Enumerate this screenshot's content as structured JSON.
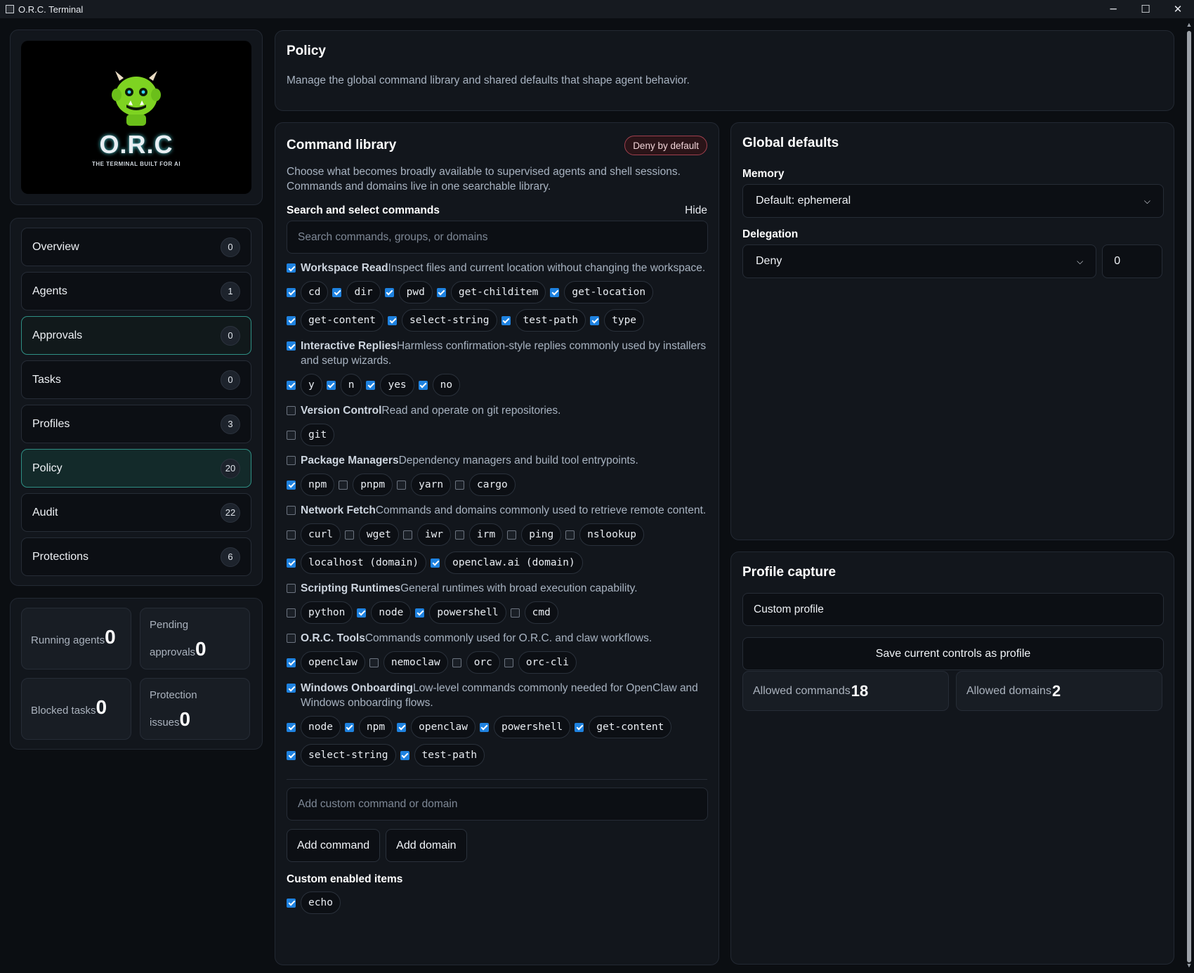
{
  "window": {
    "title": "O.R.C. Terminal",
    "minimize": "─",
    "maximize": "☐",
    "close": "✕"
  },
  "logo": {
    "title": "O.R.C",
    "subtitle": "THE TERMINAL BUILT FOR AI"
  },
  "nav": [
    {
      "label": "Overview",
      "count": "0"
    },
    {
      "label": "Agents",
      "count": "1"
    },
    {
      "label": "Approvals",
      "count": "0"
    },
    {
      "label": "Tasks",
      "count": "0"
    },
    {
      "label": "Profiles",
      "count": "3"
    },
    {
      "label": "Policy",
      "count": "20"
    },
    {
      "label": "Audit",
      "count": "22"
    },
    {
      "label": "Protections",
      "count": "6"
    }
  ],
  "stats": [
    {
      "label": "Running agents",
      "value": "0"
    },
    {
      "label": "Pending approvals",
      "value": "0"
    },
    {
      "label": "Blocked tasks",
      "value": "0"
    },
    {
      "label": "Protection issues",
      "value": "0"
    }
  ],
  "policy": {
    "title": "Policy",
    "description": "Manage the global command library and shared defaults that shape agent behavior."
  },
  "library": {
    "title": "Command library",
    "badge": "Deny by default",
    "description": "Choose what becomes broadly available to supervised agents and shell sessions. Commands and domains live in one searchable library.",
    "search_label": "Search and select commands",
    "hide_label": "Hide",
    "search_placeholder": "Search commands, groups, or domains",
    "groups": [
      {
        "name": "Workspace Read",
        "desc": "Inspect files and current location without changing the workspace.",
        "checked": true,
        "rows": [
          [
            {
              "label": "cd",
              "checked": true
            },
            {
              "label": "dir",
              "checked": true
            },
            {
              "label": "pwd",
              "checked": true
            },
            {
              "label": "get-childitem",
              "checked": true
            },
            {
              "label": "get-location",
              "checked": true
            }
          ],
          [
            {
              "label": "get-content",
              "checked": true
            },
            {
              "label": "select-string",
              "checked": true
            },
            {
              "label": "test-path",
              "checked": true
            },
            {
              "label": "type",
              "checked": true
            }
          ]
        ]
      },
      {
        "name": "Interactive Replies",
        "desc": "Harmless confirmation-style replies commonly used by installers and setup wizards.",
        "checked": true,
        "rows": [
          [
            {
              "label": "y",
              "checked": true
            },
            {
              "label": "n",
              "checked": true
            },
            {
              "label": "yes",
              "checked": true
            },
            {
              "label": "no",
              "checked": true
            }
          ]
        ]
      },
      {
        "name": "Version Control",
        "desc": "Read and operate on git repositories.",
        "checked": false,
        "rows": [
          [
            {
              "label": "git",
              "checked": false
            }
          ]
        ]
      },
      {
        "name": "Package Managers",
        "desc": "Dependency managers and build tool entrypoints.",
        "checked": false,
        "rows": [
          [
            {
              "label": "npm",
              "checked": true
            },
            {
              "label": "pnpm",
              "checked": false
            },
            {
              "label": "yarn",
              "checked": false
            },
            {
              "label": "cargo",
              "checked": false
            }
          ]
        ]
      },
      {
        "name": "Network Fetch",
        "desc": "Commands and domains commonly used to retrieve remote content.",
        "checked": false,
        "rows": [
          [
            {
              "label": "curl",
              "checked": false
            },
            {
              "label": "wget",
              "checked": false
            },
            {
              "label": "iwr",
              "checked": false
            },
            {
              "label": "irm",
              "checked": false
            },
            {
              "label": "ping",
              "checked": false
            },
            {
              "label": "nslookup",
              "checked": false
            }
          ],
          [
            {
              "label": "localhost (domain)",
              "checked": true
            },
            {
              "label": "openclaw.ai (domain)",
              "checked": true
            }
          ]
        ]
      },
      {
        "name": "Scripting Runtimes",
        "desc": "General runtimes with broad execution capability.",
        "checked": false,
        "rows": [
          [
            {
              "label": "python",
              "checked": false
            },
            {
              "label": "node",
              "checked": true
            },
            {
              "label": "powershell",
              "checked": true
            },
            {
              "label": "cmd",
              "checked": false
            }
          ]
        ]
      },
      {
        "name": "O.R.C. Tools",
        "desc": "Commands commonly used for O.R.C. and claw workflows.",
        "checked": false,
        "rows": [
          [
            {
              "label": "openclaw",
              "checked": true
            },
            {
              "label": "nemoclaw",
              "checked": false
            },
            {
              "label": "orc",
              "checked": false
            },
            {
              "label": "orc-cli",
              "checked": false
            }
          ]
        ]
      },
      {
        "name": "Windows Onboarding",
        "desc": "Low-level commands commonly needed for OpenClaw and Windows onboarding flows.",
        "checked": true,
        "rows": [
          [
            {
              "label": "node",
              "checked": true
            },
            {
              "label": "npm",
              "checked": true
            },
            {
              "label": "openclaw",
              "checked": true
            },
            {
              "label": "powershell",
              "checked": true
            },
            {
              "label": "get-content",
              "checked": true
            }
          ],
          [
            {
              "label": "select-string",
              "checked": true
            },
            {
              "label": "test-path",
              "checked": true
            }
          ]
        ]
      }
    ],
    "custom_placeholder": "Add custom command or domain",
    "add_command": "Add command",
    "add_domain": "Add domain",
    "custom_title": "Custom enabled items",
    "custom_items": [
      {
        "label": "echo",
        "checked": true
      }
    ]
  },
  "defaults": {
    "title": "Global defaults",
    "memory_label": "Memory",
    "memory_value": "Default: ephemeral",
    "delegation_label": "Delegation",
    "delegation_value": "Deny",
    "delegation_depth": "0"
  },
  "capture": {
    "title": "Profile capture",
    "profile_name": "Custom profile",
    "save_button": "Save current controls as profile",
    "allowed_commands_label": "Allowed commands",
    "allowed_commands": "18",
    "allowed_domains_label": "Allowed domains",
    "allowed_domains": "2"
  },
  "colors": {
    "accent": "#2f8f84",
    "checkbox": "#1e82e0",
    "deny_badge": "#a0404e",
    "logo_green": "#7ed321"
  }
}
